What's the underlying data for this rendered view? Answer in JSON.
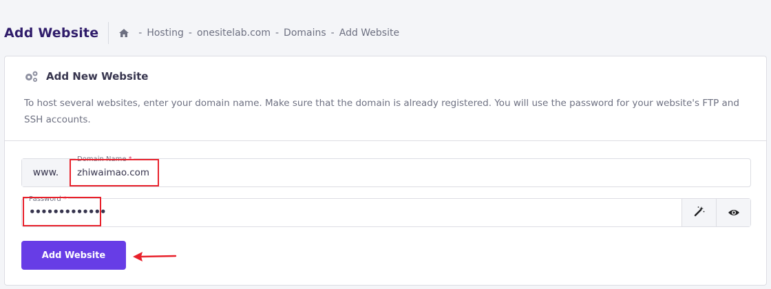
{
  "header": {
    "title": "Add Website",
    "breadcrumb": [
      "Hosting",
      "onesitelab.com",
      "Domains",
      "Add Website"
    ],
    "separator": "-"
  },
  "card": {
    "title": "Add New Website",
    "description": "To host several websites, enter your domain name. Make sure that the domain is already registered. You will use the password for your website's FTP and SSH accounts."
  },
  "form": {
    "domain_prefix": "www.",
    "domain_label": "Domain Name",
    "domain_value": "zhiwaimao.com",
    "password_label": "Password",
    "password_value": "•••••••••••••",
    "required_mark": "*",
    "submit_label": "Add Website"
  },
  "colors": {
    "accent": "#673de6",
    "annotation": "#e8202a"
  }
}
